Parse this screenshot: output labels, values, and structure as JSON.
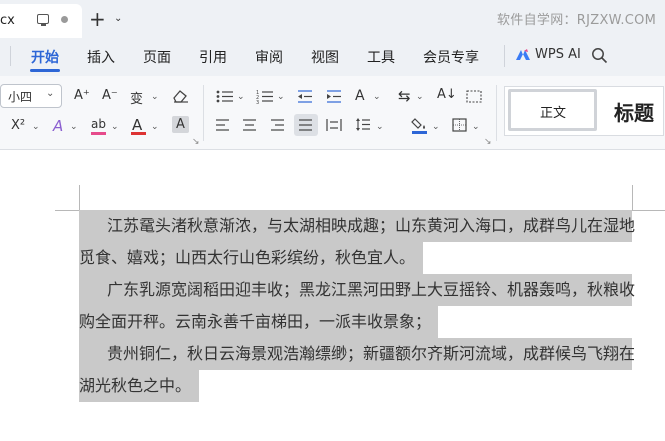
{
  "tabbar": {
    "doc_tab_name": "cx",
    "new_tab_symbol": "+",
    "new_tab_menu_symbol": "⌄",
    "watermark": "软件自学网：RJZXW.COM"
  },
  "menu": {
    "items": [
      "开始",
      "插入",
      "页面",
      "引用",
      "审阅",
      "视图",
      "工具",
      "会员专享"
    ],
    "active_index": 0,
    "wps_ai_label": "WPS AI",
    "accent_color": "#2d66d6"
  },
  "ribbon": {
    "font_size_value": "小四",
    "row1_tools": [
      "A⁺",
      "A⁻",
      "变",
      "⌫"
    ],
    "row2_tools": [
      "X²",
      "A",
      "ab",
      "A",
      "A"
    ],
    "styles": {
      "normal": "正文",
      "title": "标题"
    }
  },
  "document": {
    "lines": [
      "江苏鼋头渚秋意渐浓，与太湖相映成趣；山东黄河入海口，成群鸟儿在湿地",
      "觅食、嬉戏；山西太行山色彩缤纷，秋色宜人。",
      "广东乳源宽阔稻田迎丰收；黑龙江黑河田野上大豆摇铃、机器轰鸣，秋粮收",
      "购全面开秤。云南永善千亩梯田，一派丰收景象；",
      "贵州铜仁，秋日云海景观浩瀚缥缈；新疆额尔齐斯河流域，成群候鸟飞翔在",
      "湖光秋色之中。"
    ],
    "selection_color": "#c9c9c9"
  }
}
